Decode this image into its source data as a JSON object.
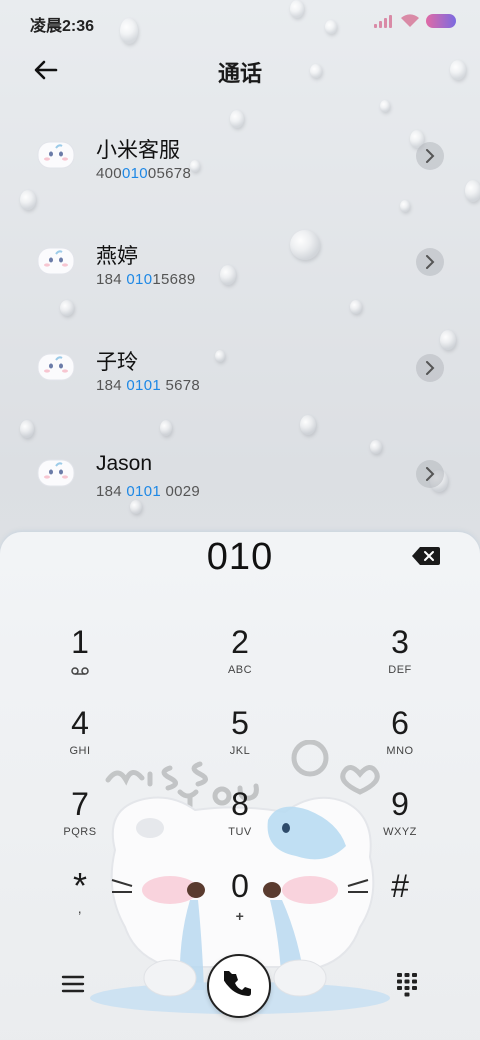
{
  "status_bar": {
    "time": "凌晨2:36",
    "icons": [
      "signal-icon",
      "wifi-icon",
      "battery-icon"
    ]
  },
  "header": {
    "title": "通话",
    "back_icon": "back-arrow-icon"
  },
  "contacts": [
    {
      "name": "小米客服",
      "number_prefix": "400",
      "number_match": "010",
      "number_suffix": "05678"
    },
    {
      "name": "燕婷",
      "number_prefix": "184 ",
      "number_match": "010",
      "number_suffix": "15689"
    },
    {
      "name": "子玲",
      "number_prefix": "184 ",
      "number_match": "0101",
      "number_suffix": " 5678"
    },
    {
      "name": "Jason",
      "number_prefix": "184 ",
      "number_match": "0101",
      "number_suffix": " 0029"
    }
  ],
  "dialer": {
    "input_value": "010",
    "keys": [
      {
        "digit": "1",
        "letters": ""
      },
      {
        "digit": "2",
        "letters": "ABC"
      },
      {
        "digit": "3",
        "letters": "DEF"
      },
      {
        "digit": "4",
        "letters": "GHI"
      },
      {
        "digit": "5",
        "letters": "JKL"
      },
      {
        "digit": "6",
        "letters": "MNO"
      },
      {
        "digit": "7",
        "letters": "PQRS"
      },
      {
        "digit": "8",
        "letters": "TUV"
      },
      {
        "digit": "9",
        "letters": "WXYZ"
      },
      {
        "digit": "*",
        "letters": ","
      },
      {
        "digit": "0",
        "letters": "+"
      },
      {
        "digit": "#",
        "letters": ""
      }
    ]
  },
  "colors": {
    "match_highlight": "#1e88e5",
    "accent_battery": "#e06aa5"
  }
}
